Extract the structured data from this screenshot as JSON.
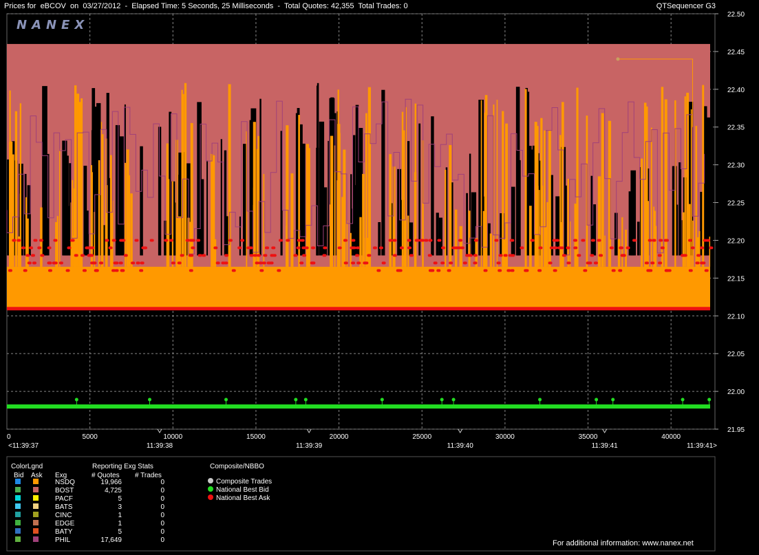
{
  "window": {
    "title": "Prices for  eBCOV  on  03/27/2012  -  Elapsed Time: 5 Seconds, 25 Milliseconds  -  Total Quotes: 42,355  Total Trades: 0",
    "app_name": "QTSequencer G3"
  },
  "logo_text": "NANEX",
  "chart_data": {
    "type": "line",
    "ylim": [
      21.95,
      22.5
    ],
    "y_ticks": [
      "22.50",
      "22.45",
      "22.40",
      "22.35",
      "22.30",
      "22.25",
      "22.20",
      "22.15",
      "22.10",
      "22.05",
      "22.00",
      "21.95"
    ],
    "y_tick_values": [
      22.5,
      22.45,
      22.4,
      22.35,
      22.3,
      22.25,
      22.2,
      22.15,
      22.1,
      22.05,
      22.0,
      21.95
    ],
    "xlim": [
      0,
      42355
    ],
    "x_ticks": [
      "0",
      "5000",
      "10000",
      "15000",
      "20000",
      "25000",
      "30000",
      "35000",
      "40000"
    ],
    "x_tick_values": [
      0,
      5000,
      10000,
      15000,
      20000,
      25000,
      30000,
      35000,
      40000
    ],
    "time_labels": [
      {
        "label": "<11:39:37",
        "x": 0
      },
      {
        "label": "11:39:38",
        "x": 9200
      },
      {
        "label": "11:39:39",
        "x": 18200
      },
      {
        "label": "11:39:40",
        "x": 27300
      },
      {
        "label": "11:39:41",
        "x": 36000
      },
      {
        "label": "11:39:41>",
        "x": 42355
      }
    ],
    "series": [
      {
        "name": "National Best Bid",
        "color": "#22dd22",
        "level": 21.98
      },
      {
        "name": "National Best Ask",
        "color": "#ee1111",
        "level_range": [
          22.11,
          22.2
        ]
      },
      {
        "name": "BOST Ask",
        "color": "#c86464",
        "level": 22.46
      },
      {
        "name": "NSDQ Ask",
        "color": "#ff9900",
        "level_range": [
          22.11,
          22.41
        ]
      },
      {
        "name": "PHIL Ask",
        "color": "#a0407a",
        "level_range": [
          22.18,
          22.39
        ]
      }
    ],
    "bid_trade_marks_x": [
      4200,
      8600,
      13200,
      17400,
      18000,
      22600,
      26200,
      26900,
      32100,
      35500,
      36500,
      40700,
      42300
    ]
  },
  "legend": {
    "color_legend_title": "ColorLgnd",
    "bid_header": "Bid",
    "ask_header": "Ask",
    "exg_header": "Exg",
    "stats_title": "Reporting Exg Stats",
    "quotes_header": "# Quotes",
    "trades_header": "# Trades",
    "composite_title": "Composite/NBBO",
    "rows": [
      {
        "exg": "NSDQ",
        "quotes": "19,966",
        "trades": "0",
        "bid_color": "#1e88e5",
        "ask_color": "#ff9900"
      },
      {
        "exg": "BOST",
        "quotes": "4,725",
        "trades": "0",
        "bid_color": "#4caf50",
        "ask_color": "#c86464"
      },
      {
        "exg": "PACF",
        "quotes": "5",
        "trades": "0",
        "bid_color": "#00d8d8",
        "ask_color": "#ffee00"
      },
      {
        "exg": "BATS",
        "quotes": "3",
        "trades": "0",
        "bid_color": "#40c8f0",
        "ask_color": "#f0d080"
      },
      {
        "exg": "CINC",
        "quotes": "1",
        "trades": "0",
        "bid_color": "#20a0a0",
        "ask_color": "#a0a020"
      },
      {
        "exg": "EDGE",
        "quotes": "1",
        "trades": "0",
        "bid_color": "#40b040",
        "ask_color": "#c07050"
      },
      {
        "exg": "BATY",
        "quotes": "5",
        "trades": "0",
        "bid_color": "#3070c0",
        "ask_color": "#e05020"
      },
      {
        "exg": "PHIL",
        "quotes": "17,649",
        "trades": "0",
        "bid_color": "#60b040",
        "ask_color": "#a0407a"
      }
    ],
    "composite_items": [
      {
        "label": "Composite Trades",
        "color": "#c8c8c8"
      },
      {
        "label": "National Best Bid",
        "color": "#22dd22"
      },
      {
        "label": "National Best Ask",
        "color": "#ee1111"
      }
    ]
  },
  "footer_text": "For additional information: www.nanex.net"
}
